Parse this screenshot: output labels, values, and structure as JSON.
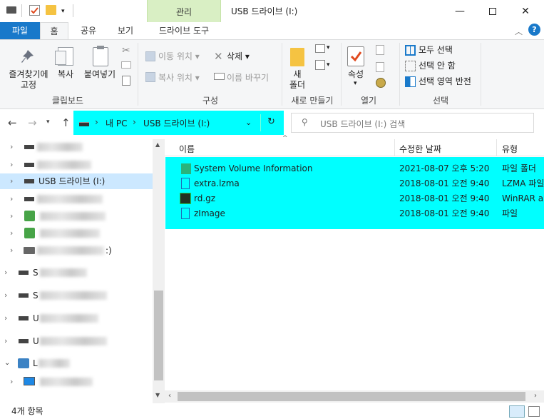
{
  "title": {
    "context_tab": "관리",
    "text": "USB 드라이브 (I:)"
  },
  "tabs": {
    "file": "파일",
    "home": "홈",
    "share": "공유",
    "view": "보기",
    "drive_tools": "드라이브 도구"
  },
  "ribbon": {
    "clipboard": {
      "pin": "즐겨찾기에\n고정",
      "copy": "복사",
      "paste": "붙여넣기",
      "label": "클립보드"
    },
    "organize": {
      "move_to": "이동 위치",
      "copy_to": "복사 위치",
      "delete": "삭제",
      "rename": "이름 바꾸기",
      "label": "구성"
    },
    "new": {
      "new_folder": "새\n폴더",
      "label": "새로 만들기"
    },
    "open": {
      "properties": "속성",
      "label": "열기"
    },
    "select": {
      "select_all": "모두 선택",
      "select_none": "선택 안 함",
      "invert": "선택 영역 반전",
      "label": "선택"
    }
  },
  "address": {
    "pc": "내 PC",
    "drive": "USB 드라이브 (I:)"
  },
  "search": {
    "placeholder": "USB 드라이브 (I:) 검색"
  },
  "nav": {
    "selected": "USB 드라이브 (I:)",
    "partial_items": [
      ":)",
      "S",
      "S",
      "U",
      "U",
      "L"
    ]
  },
  "columns": {
    "name": "이름",
    "date": "수정한 날짜",
    "type": "유형"
  },
  "files": [
    {
      "name": "System Volume Information",
      "date": "2021-08-07 오후 5:20",
      "type": "파일 폴더",
      "icon": "folder-icon"
    },
    {
      "name": "extra.lzma",
      "date": "2018-08-01 오전 9:40",
      "type": "LZMA 파일",
      "icon": "file-icon"
    },
    {
      "name": "rd.gz",
      "date": "2018-08-01 오전 9:40",
      "type": "WinRAR ar",
      "icon": "archive-icon"
    },
    {
      "name": "zImage",
      "date": "2018-08-01 오전 9:40",
      "type": "파일",
      "icon": "file-icon"
    }
  ],
  "status": {
    "count": "4개 항목"
  }
}
